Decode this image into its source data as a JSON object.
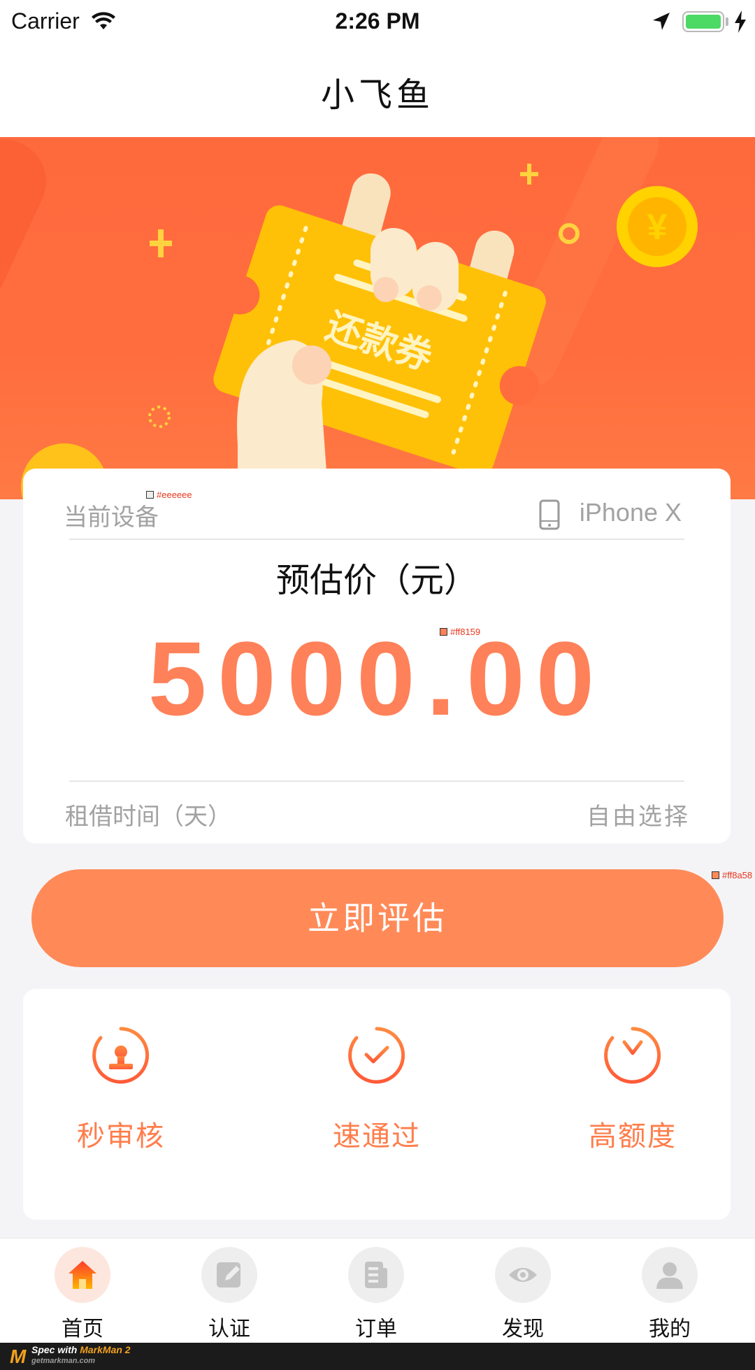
{
  "status_bar": {
    "carrier": "Carrier",
    "time": "2:26 PM",
    "battery_color": "#4cd964"
  },
  "nav": {
    "title": "小飞鱼"
  },
  "banner": {
    "coupon_text": "还款券"
  },
  "estimate": {
    "device_label": "当前设备",
    "device_value": "iPhone X",
    "price_label": "预估价（元）",
    "price_value": "5000.00",
    "rent_label": "租借时间（天）",
    "rent_value": "自由选择",
    "spec_tags": {
      "divider_color": "#eeeeee",
      "price_color": "#ff8159",
      "button_color": "#ff8a58"
    }
  },
  "primary_button": {
    "label": "立即评估"
  },
  "features": [
    {
      "label": "秒审核",
      "icon": "stamp-icon"
    },
    {
      "label": "速通过",
      "icon": "check-icon"
    },
    {
      "label": "高额度",
      "icon": "yuan-icon"
    }
  ],
  "tabs": [
    {
      "label": "首页",
      "icon": "home-icon",
      "active": true
    },
    {
      "label": "认证",
      "icon": "edit-icon",
      "active": false
    },
    {
      "label": "订单",
      "icon": "order-icon",
      "active": false
    },
    {
      "label": "发现",
      "icon": "eye-icon",
      "active": false
    },
    {
      "label": "我的",
      "icon": "user-icon",
      "active": false
    }
  ],
  "footer": {
    "logo": "M",
    "spec_prefix": "Spec with ",
    "brand": "MarkMan 2",
    "domain": "getmarkman.com"
  },
  "colors": {
    "accent": "#ff8a58",
    "price": "#ff8159",
    "banner": "#ff6a3d",
    "divider": "#eeeeee"
  }
}
